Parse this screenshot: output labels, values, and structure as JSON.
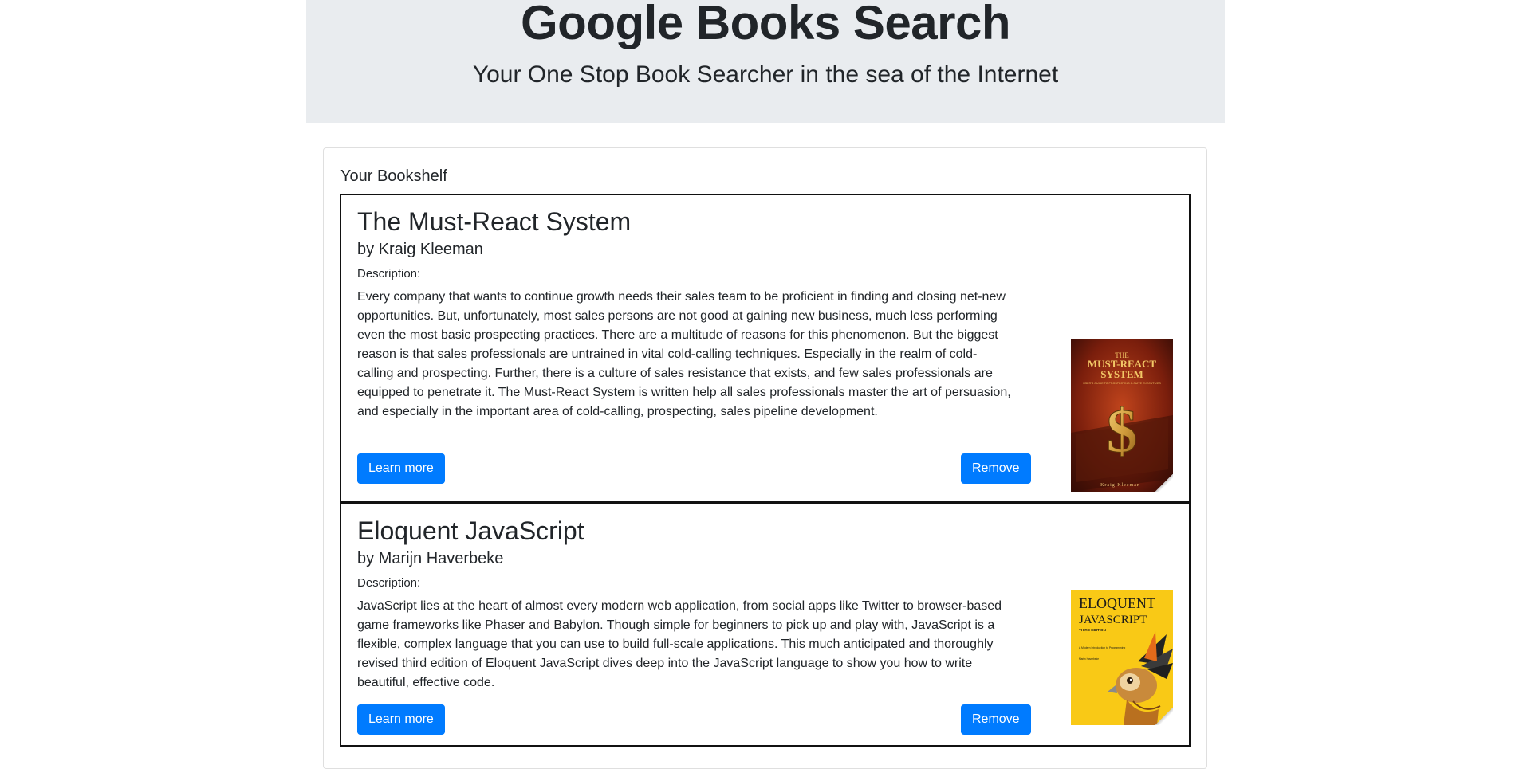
{
  "header": {
    "title": "Google Books Search",
    "subtitle": "Your One Stop Book Searcher in the sea of the Internet"
  },
  "bookshelf": {
    "title": "Your Bookshelf",
    "books": [
      {
        "title": "The Must-React System",
        "author": "by Kraig Kleeman",
        "description_label": "Description:",
        "description": "Every company that wants to continue growth needs their sales team to be proficient in finding and closing net-new opportunities. But, unfortunately, most sales persons are not good at gaining new business, much less performing even the most basic prospecting practices. There are a multitude of reasons for this phenomenon. But the biggest reason is that sales professionals are untrained in vital cold-calling techniques. Especially in the realm of cold-calling and prospecting. Further, there is a culture of sales resistance that exists, and few sales professionals are equipped to penetrate it. The Must-React System is written help all sales professionals master the art of persuasion, and especially in the important area of cold-calling, prospecting, sales pipeline development.",
        "learn_more_label": "Learn more",
        "remove_label": "Remove",
        "cover": {
          "line1": "THE",
          "line2": "MUST-REACT",
          "line3": "SYSTEM",
          "tagline": "USER'S GUIDE TO PROSPECTING C-SUITE EXECUTIVES",
          "author": "Kraig Kleeman",
          "symbol": "$"
        }
      },
      {
        "title": "Eloquent JavaScript",
        "author": "by Marijn Haverbeke",
        "description_label": "Description:",
        "description": "JavaScript lies at the heart of almost every modern web application, from social apps like Twitter to browser-based game frameworks like Phaser and Babylon. Though simple for beginners to pick up and play with, JavaScript is a flexible, complex language that you can use to build full-scale applications. This much anticipated and thoroughly revised third edition of Eloquent JavaScript dives deep into the JavaScript language to show you how to write beautiful, effective code.",
        "learn_more_label": "Learn more",
        "remove_label": "Remove",
        "cover": {
          "line1": "ELOQUENT",
          "line2": "JAVASCRIPT",
          "edition": "THIRD EDITION",
          "subtitle": "A Modern Introduction to Programming",
          "author": "Marijn Haverbeke"
        }
      }
    ]
  },
  "colors": {
    "primary": "#007bff",
    "jumbotron_bg": "#e9ecef",
    "text": "#212529"
  }
}
